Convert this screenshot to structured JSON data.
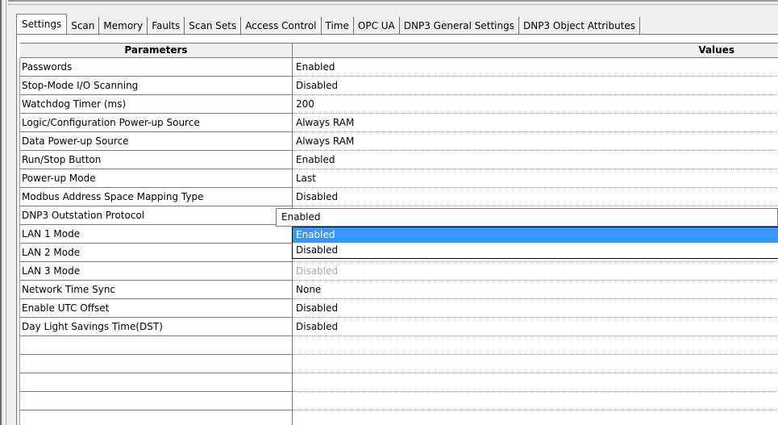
{
  "tabs": [
    {
      "label": "Settings",
      "active": true
    },
    {
      "label": "Scan",
      "active": false
    },
    {
      "label": "Memory",
      "active": false
    },
    {
      "label": "Faults",
      "active": false
    },
    {
      "label": "Scan Sets",
      "active": false
    },
    {
      "label": "Access Control",
      "active": false
    },
    {
      "label": "Time",
      "active": false
    },
    {
      "label": "OPC UA",
      "active": false
    },
    {
      "label": "DNP3 General Settings",
      "active": false
    },
    {
      "label": "DNP3 Object Attributes",
      "active": false
    }
  ],
  "table": {
    "header_params": "Parameters",
    "header_values": "Values",
    "rows": [
      {
        "param": "Passwords",
        "value": "Enabled"
      },
      {
        "param": "Stop-Mode I/O Scanning",
        "value": "Disabled"
      },
      {
        "param": "Watchdog Timer (ms)",
        "value": "200"
      },
      {
        "param": "Logic/Configuration Power-up Source",
        "value": "Always RAM"
      },
      {
        "param": "Data Power-up Source",
        "value": "Always RAM"
      },
      {
        "param": "Run/Stop Button",
        "value": "Enabled"
      },
      {
        "param": "Power-up Mode",
        "value": "Last"
      },
      {
        "param": "Modbus Address Space Mapping Type",
        "value": "Disabled"
      },
      {
        "param": "DNP3 Outstation Protocol",
        "value": ""
      },
      {
        "param": "LAN 1 Mode",
        "value": ""
      },
      {
        "param": "LAN 2 Mode",
        "value": ""
      },
      {
        "param": "LAN 3 Mode",
        "value": "Disabled",
        "greyed": true
      },
      {
        "param": "Network Time Sync",
        "value": "None"
      },
      {
        "param": "Enable UTC Offset",
        "value": "Disabled"
      },
      {
        "param": "Day Light Savings Time(DST)",
        "value": "Disabled"
      },
      {
        "param": "",
        "value": ""
      },
      {
        "param": "",
        "value": ""
      },
      {
        "param": "",
        "value": ""
      },
      {
        "param": "",
        "value": ""
      },
      {
        "param": "",
        "value": ""
      }
    ]
  },
  "combo": {
    "current_value": "Enabled",
    "options": [
      {
        "label": "Enabled",
        "selected": true
      },
      {
        "label": "Disabled",
        "selected": false
      }
    ]
  },
  "colors": {
    "selection": "#3399ff",
    "greyed_text": "#a8a8a8"
  }
}
